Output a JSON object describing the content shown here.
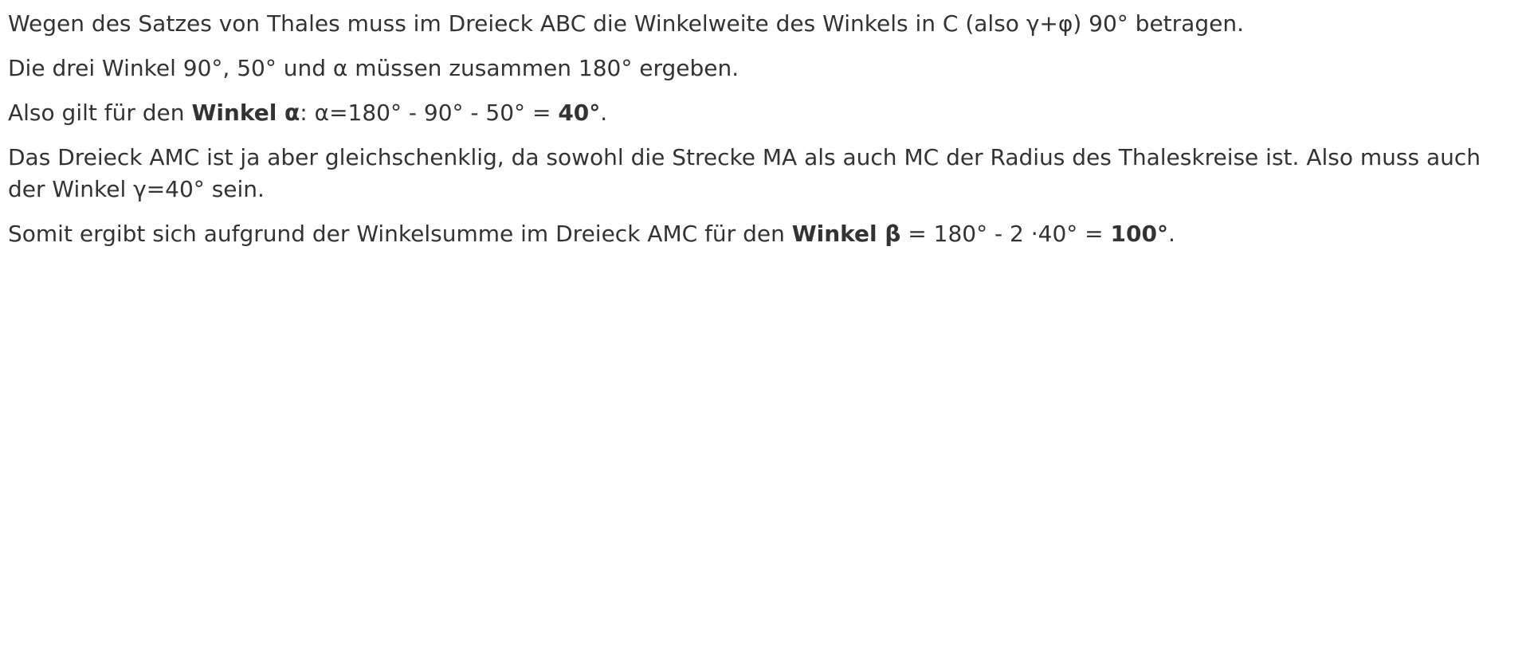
{
  "paragraphs": {
    "p1": {
      "text": "Wegen des Satzes von Thales muss im Dreieck ABC die Winkelweite des Winkels in C (also γ+φ) 90° betragen."
    },
    "p2": {
      "text": "Die drei Winkel 90°, 50° und α müssen zusammen 180° ergeben."
    },
    "p3": {
      "before": "Also gilt für den ",
      "bold1": "Winkel α",
      "middle": ": α=180° - 90° - 50° = ",
      "bold2": "40°",
      "after": "."
    },
    "p4": {
      "text": "Das Dreieck AMC ist ja aber gleichschenklig, da sowohl die Strecke MA als auch MC der Radius des Thaleskreise ist. Also muss auch der Winkel γ=40° sein."
    },
    "p5": {
      "before": "Somit ergibt sich aufgrund der Winkelsumme im Dreieck AMC für den ",
      "bold1": "Winkel β",
      "middle": " = 180° - 2 ·40° = ",
      "bold2": "100°",
      "after": "."
    }
  }
}
